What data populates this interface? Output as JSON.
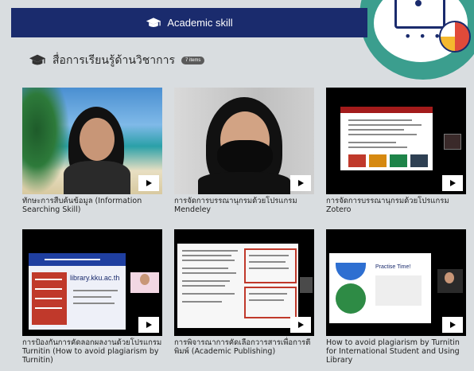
{
  "header": {
    "title": "Academic skill"
  },
  "section": {
    "title": "สื่อการเรียนรู้ด้านวิชาการ",
    "badge": "7 items"
  },
  "videos": [
    {
      "caption": "ทักษะการสืบค้นข้อมูล (Information Searching Skill)"
    },
    {
      "caption": "การจัดการบรรณานุกรมด้วยโปรแกรม Mendeley"
    },
    {
      "caption": "การจัดการบรรณานุกรมด้วยโปรแกรม Zotero"
    },
    {
      "caption": "การป้องกันการคัดลอกผลงานด้วยโปรแกรม Turnitin (How to avoid plagiarism by Turnitin)"
    },
    {
      "caption": "การพิจารณาการคัดเลือกวารสารเพื่อการตีพิมพ์ (Academic Publishing)"
    },
    {
      "caption": "How to avoid plagiarism by Turnitin for International Student and Using Library"
    }
  ],
  "slides": {
    "turnitin_url": "library.kku.ac.th",
    "practice_title": "Practise Time!"
  },
  "colors": {
    "header_bg": "#1a2b6d",
    "page_bg": "#d9dde0",
    "accent_teal": "#3b9e8e"
  }
}
